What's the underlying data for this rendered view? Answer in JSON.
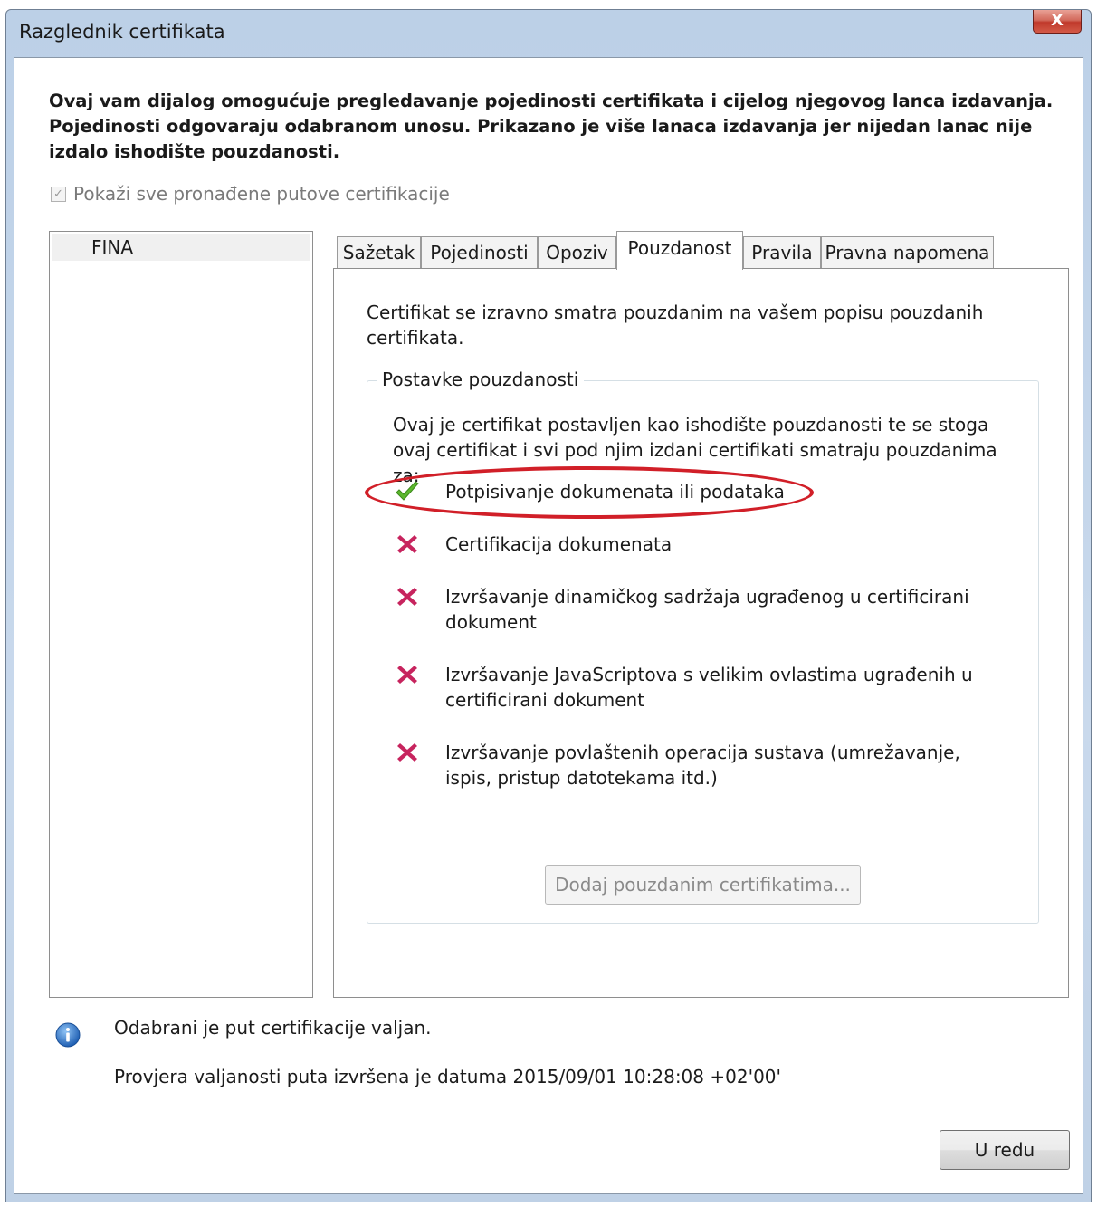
{
  "window": {
    "title": "Razglednik certifikata",
    "close_label": "X"
  },
  "intro_text": "Ovaj vam dijalog omogućuje pregledavanje pojedinosti certifikata i cijelog njegovog lanca izdavanja. Pojedinosti odgovaraju odabranom unosu. Prikazano je više lanaca izdavanja jer nijedan lanac nije izdalo ishodište pouzdanosti.",
  "show_all_paths": {
    "label": "Pokaži sve pronađene putove certifikacije",
    "checked": true,
    "enabled": false
  },
  "tree": {
    "items": [
      {
        "label": "FINA",
        "selected": true
      }
    ]
  },
  "tabs": [
    {
      "label": "Sažetak",
      "active": false
    },
    {
      "label": "Pojedinosti",
      "active": false
    },
    {
      "label": "Opoziv",
      "active": false
    },
    {
      "label": "Pouzdanost",
      "active": true
    },
    {
      "label": "Pravila",
      "active": false
    },
    {
      "label": "Pravna napomena",
      "active": false
    }
  ],
  "trust_panel": {
    "message": "Certifikat se izravno smatra pouzdanim na vašem popisu pouzdanih certifikata.",
    "group_title": "Postavke pouzdanosti",
    "group_description": "Ovaj je certifikat postavljen kao ishodište pouzdanosti te se stoga ovaj certifikat i svi pod njim izdani certifikati smatraju pouzdanima za:",
    "permissions": [
      {
        "label": "Potpisivanje dokumenata ili podataka",
        "allowed": true,
        "icon": "green-check-icon"
      },
      {
        "label": "Certifikacija dokumenata",
        "allowed": false,
        "icon": "red-x-icon"
      },
      {
        "label": "Izvršavanje dinamičkog sadržaja ugrađenog u certificirani dokument",
        "allowed": false,
        "icon": "red-x-icon"
      },
      {
        "label": "Izvršavanje JavaScriptova s velikim ovlastima ugrađenih u certificirani dokument",
        "allowed": false,
        "icon": "red-x-icon"
      },
      {
        "label": "Izvršavanje povlaštenih operacija sustava (umrežavanje, ispis, pristup datotekama itd.)",
        "allowed": false,
        "icon": "red-x-icon"
      }
    ],
    "add_button_label": "Dodaj pouzdanim certifikatima..."
  },
  "status": {
    "icon": "info-icon",
    "valid_text": "Odabrani je put certifikacije valjan.",
    "check_text": "Provjera valjanosti puta izvršena je datuma 2015/09/01 10:28:08 +02'00'"
  },
  "ok_button_label": "U redu",
  "colors": {
    "highlight_ellipse": "#d11f28",
    "check": "#4caf2a",
    "cross": "#c2185b"
  }
}
